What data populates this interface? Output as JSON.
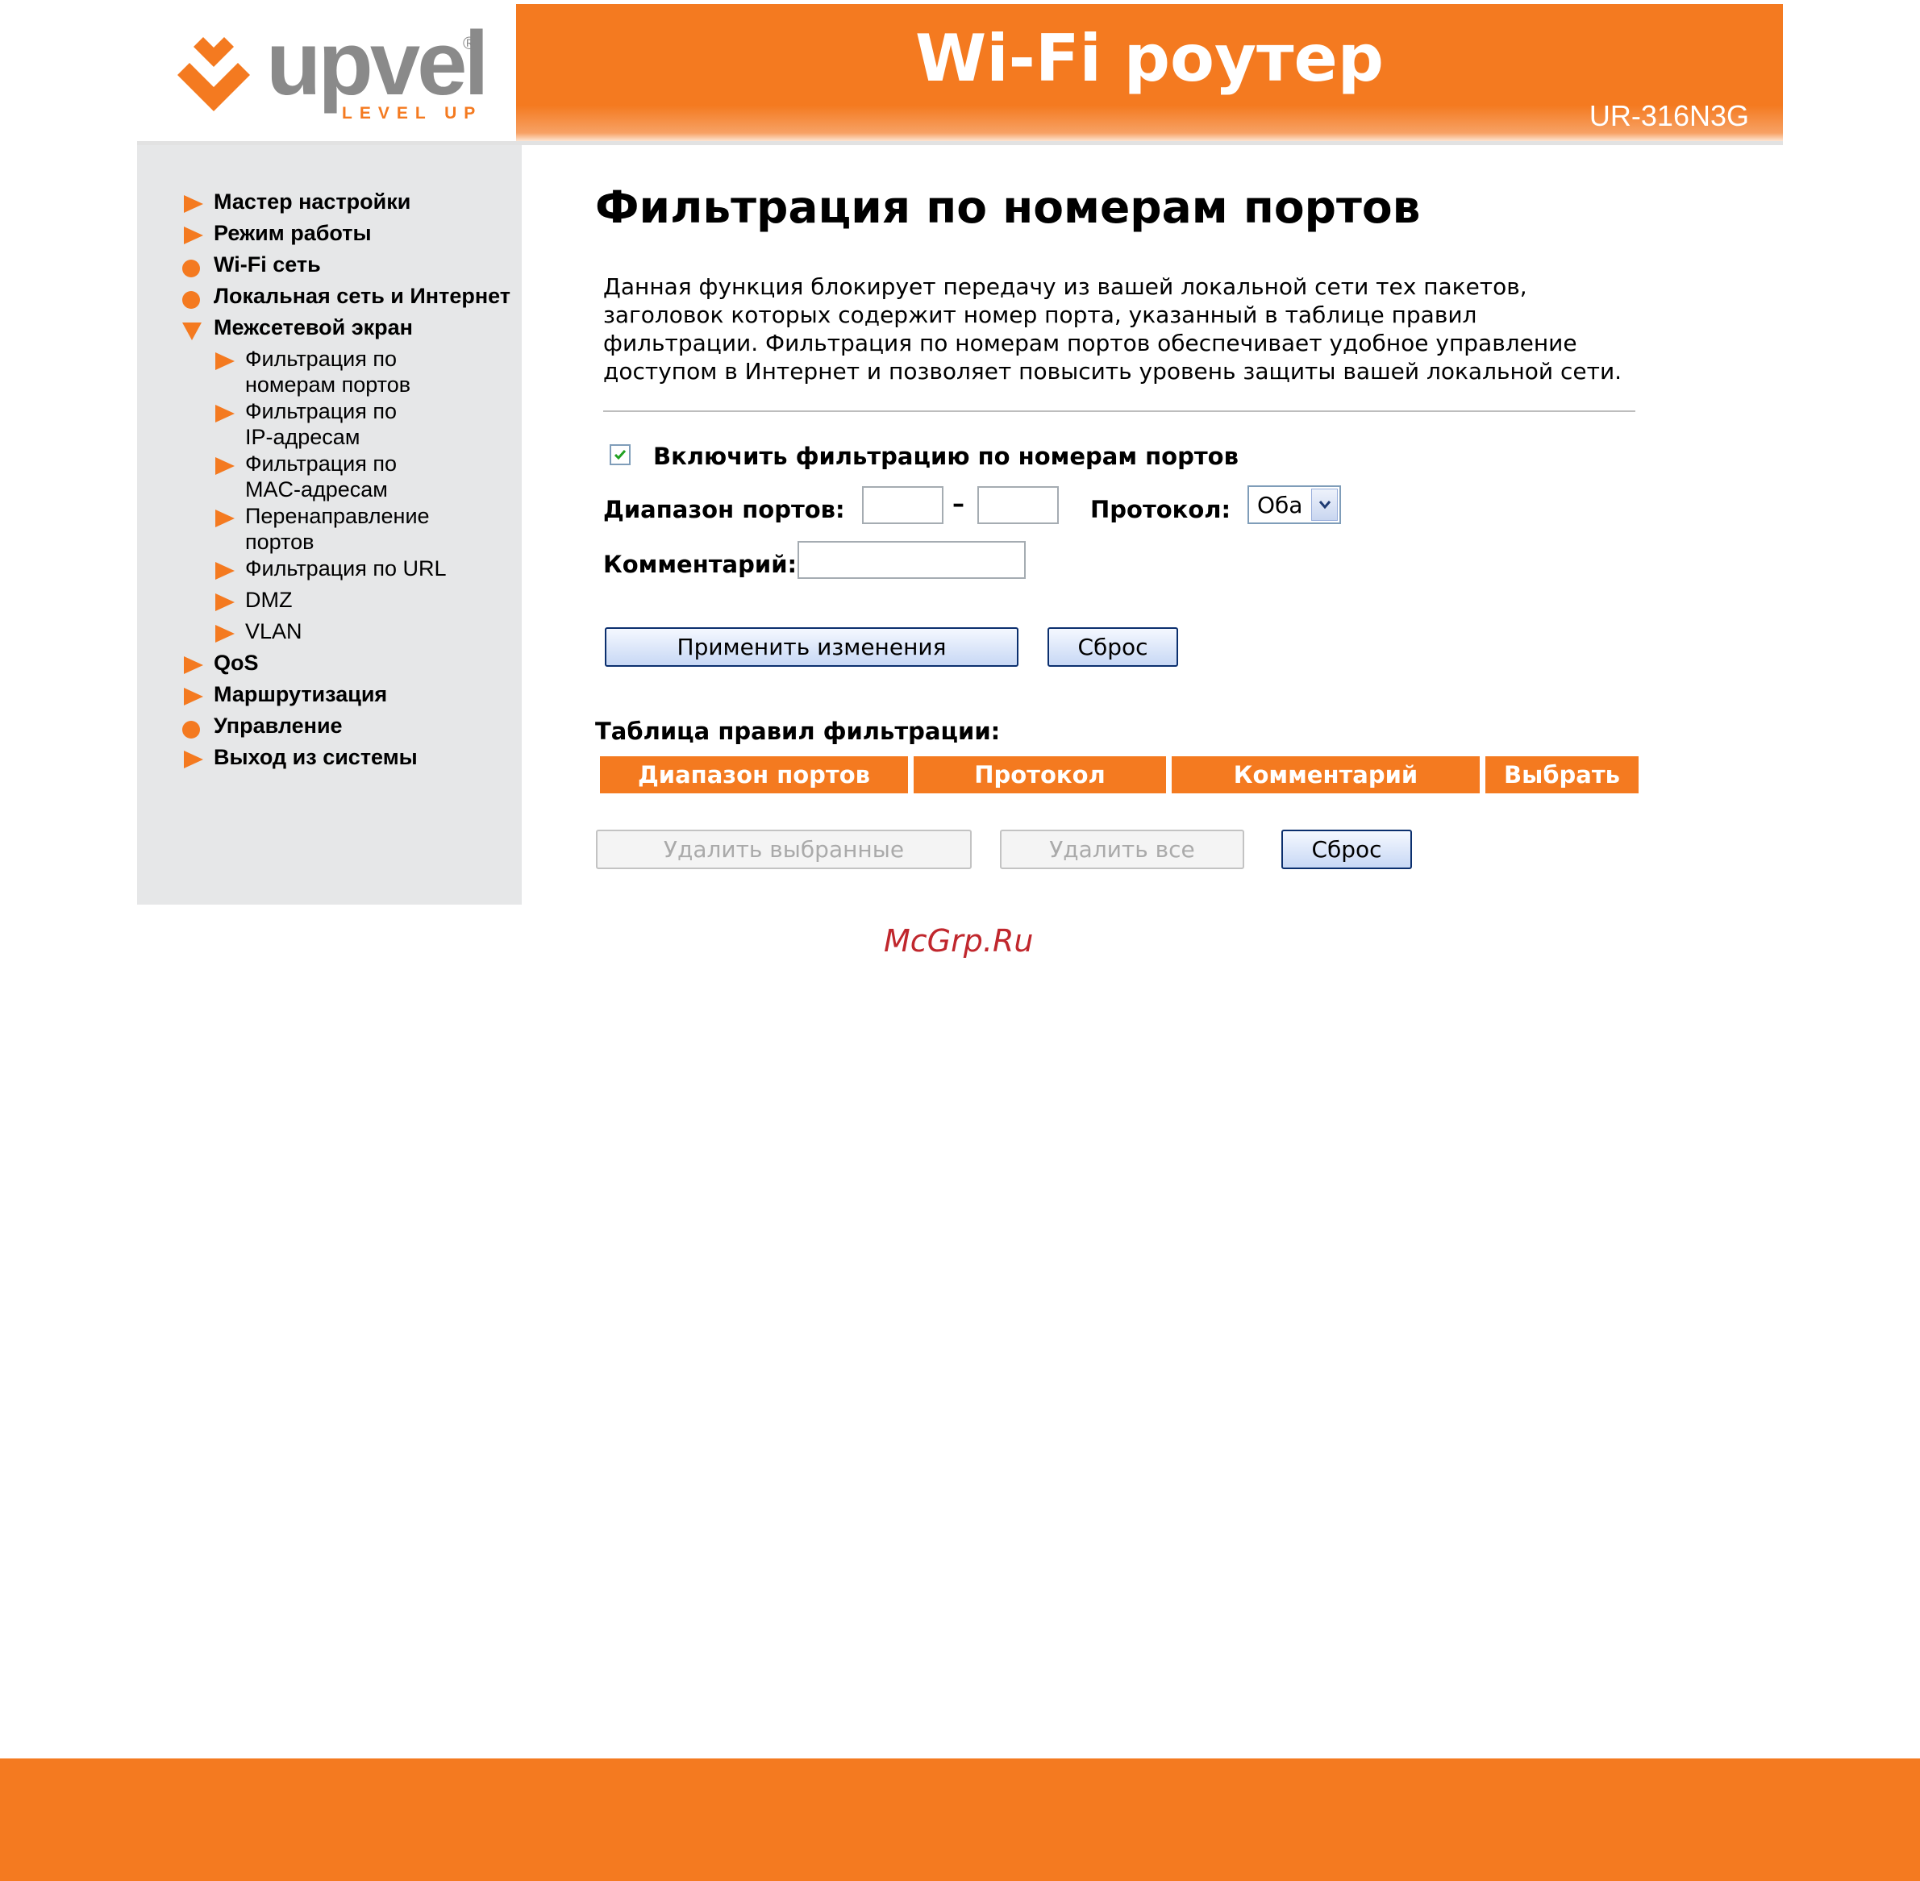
{
  "brand": {
    "logo_text": "upvel",
    "logo_reg": "®",
    "tagline": "LEVEL UP",
    "title": "Wi-Fi роутер",
    "model": "UR-316N3G",
    "accent_color": "#f47a20"
  },
  "sidebar": {
    "items": [
      {
        "label": "Мастер настройки",
        "marker": "triangle-right",
        "bold": true
      },
      {
        "label": "Режим работы",
        "marker": "triangle-right",
        "bold": true
      },
      {
        "label": "Wi-Fi сеть",
        "marker": "dot",
        "bold": true
      },
      {
        "label": "Локальная сеть и Интернет",
        "marker": "dot",
        "bold": true
      },
      {
        "label": "Межсетевой экран",
        "marker": "triangle-down",
        "bold": true
      },
      {
        "label": "Фильтрация по номерам портов",
        "marker": "triangle-right",
        "bold": false
      },
      {
        "label": "Фильтрация по IP-адресам",
        "marker": "triangle-right",
        "bold": false
      },
      {
        "label": "Фильтрация по MAC-адресам",
        "marker": "triangle-right",
        "bold": false
      },
      {
        "label": "Перенаправление портов",
        "marker": "triangle-right",
        "bold": false
      },
      {
        "label": "Фильтрация по URL",
        "marker": "triangle-right",
        "bold": false
      },
      {
        "label": "DMZ",
        "marker": "triangle-right",
        "bold": false
      },
      {
        "label": "VLAN",
        "marker": "triangle-right",
        "bold": false
      },
      {
        "label": "QoS",
        "marker": "triangle-right",
        "bold": true
      },
      {
        "label": "Маршрутизация",
        "marker": "triangle-right",
        "bold": true
      },
      {
        "label": "Управление",
        "marker": "dot",
        "bold": true
      },
      {
        "label": "Выход из системы",
        "marker": "triangle-right",
        "bold": true
      }
    ]
  },
  "main": {
    "title": "Фильтрация по номерам портов",
    "description_lines": [
      "Данная функция блокирует передачу из вашей локальной сети тех пакетов,",
      "заголовок которых содержит номер порта, указанный в таблице правил",
      "фильтрации. Фильтрация по номерам портов обеспечивает удобное управление",
      "доступом в Интернет и позволяет повысить уровень защиты вашей локальной сети."
    ],
    "form": {
      "enable_label": "Включить фильтрацию по номерам портов",
      "enable_checked": true,
      "port_range_label": "Диапазон портов:",
      "port_from": "",
      "range_separator": "–",
      "port_to": "",
      "protocol_label": "Протокол:",
      "protocol_value": "Оба",
      "comment_label": "Комментарий:",
      "comment_value": "",
      "apply_label": "Применить изменения",
      "reset_label": "Сброс"
    },
    "table": {
      "title": "Таблица правил фильтрации:",
      "columns": [
        "Диапазон портов",
        "Протокол",
        "Комментарий",
        "Выбрать"
      ],
      "rows": [],
      "delete_selected_label": "Удалить выбранные",
      "delete_all_label": "Удалить все",
      "reset_label": "Сброс"
    }
  },
  "watermark": "McGrp.Ru"
}
